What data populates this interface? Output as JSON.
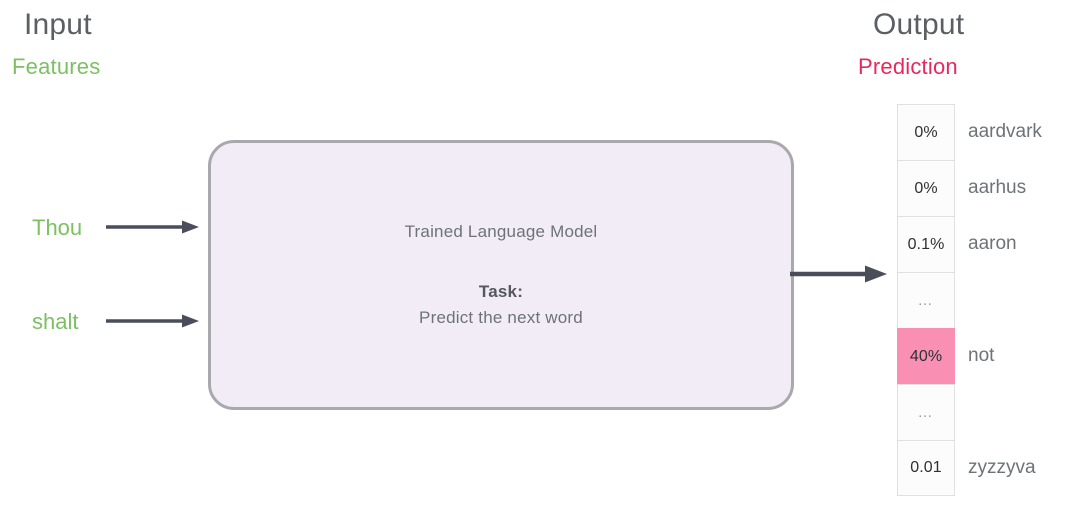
{
  "input": {
    "heading": "Input",
    "subheading": "Features",
    "subheading_color": "#7cc062",
    "tokens": [
      {
        "label": "Thou",
        "arrow_icon": "arrow-right-icon"
      },
      {
        "label": "shalt",
        "arrow_icon": "arrow-right-icon"
      }
    ]
  },
  "model": {
    "title": "Trained Language Model",
    "task_label": "Task:",
    "task_text": "Predict the next word",
    "fill_color": "#f1ecf6",
    "border_color": "#a9a9ad",
    "output_arrow_icon": "arrow-right-icon"
  },
  "output": {
    "heading": "Output",
    "subheading": "Prediction",
    "subheading_color": "#e8285c",
    "highlight_color": "#fa8fb4",
    "rows": [
      {
        "probability": "0%",
        "word": "aardvark",
        "highlighted": false
      },
      {
        "probability": "0%",
        "word": "aarhus",
        "highlighted": false
      },
      {
        "probability": "0.1%",
        "word": "aaron",
        "highlighted": false
      },
      {
        "probability": "…",
        "word": "",
        "highlighted": false
      },
      {
        "probability": "40%",
        "word": "not",
        "highlighted": true
      },
      {
        "probability": "…",
        "word": "",
        "highlighted": false
      },
      {
        "probability": "0.01",
        "word": "zyzzyva",
        "highlighted": false
      }
    ]
  }
}
